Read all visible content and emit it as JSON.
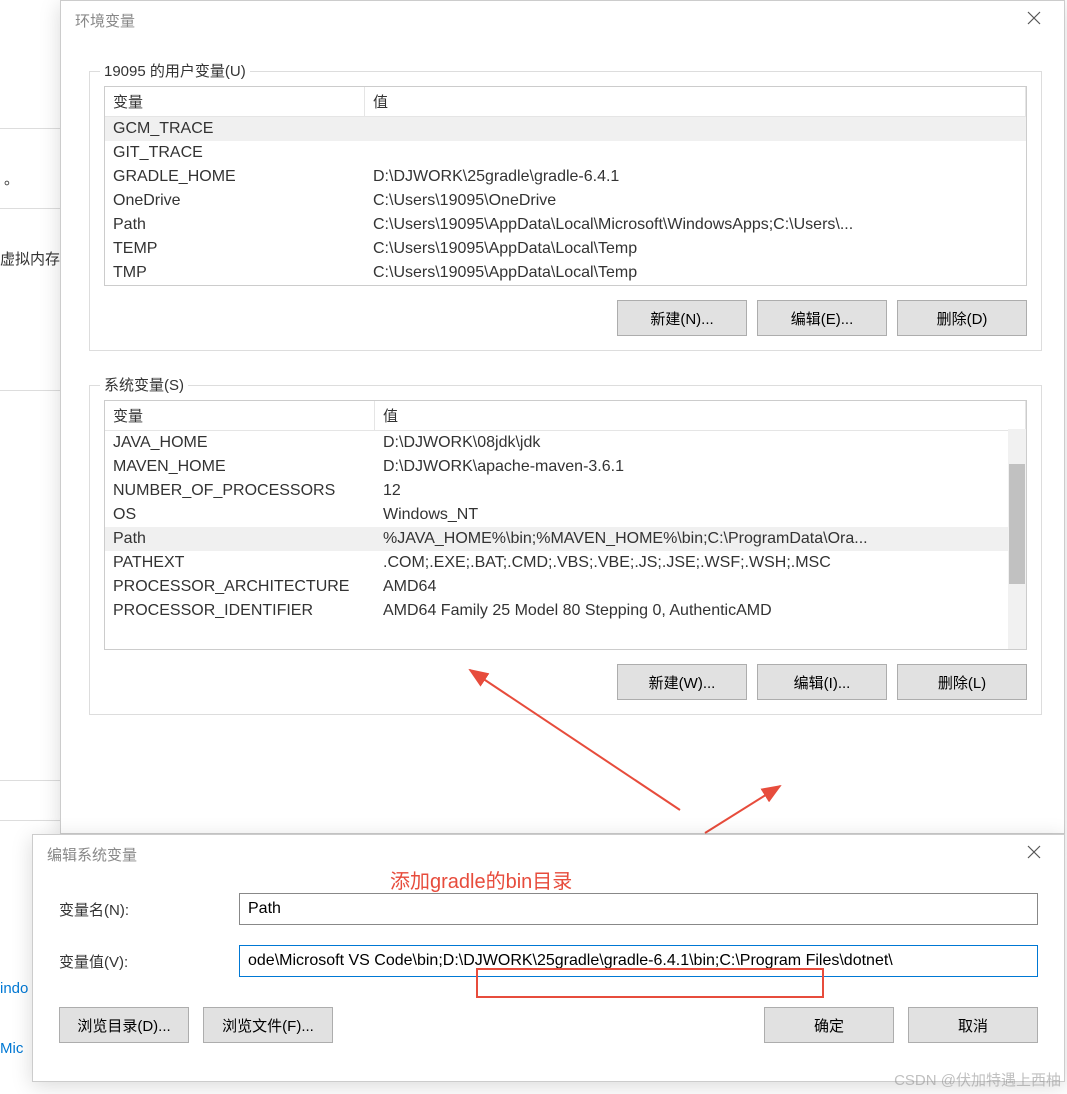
{
  "bg": {
    "dot": "。",
    "virtual": "虚拟内存",
    "windo": "indo",
    "mic": "Mic"
  },
  "dialog_env": {
    "title": "环境变量",
    "user_group_label": "19095 的用户变量(U)",
    "sys_group_label": "系统变量(S)",
    "col_name": "变量",
    "col_value": "值",
    "user_vars": [
      {
        "name": "GCM_TRACE",
        "value": ""
      },
      {
        "name": "GIT_TRACE",
        "value": ""
      },
      {
        "name": "GRADLE_HOME",
        "value": "D:\\DJWORK\\25gradle\\gradle-6.4.1"
      },
      {
        "name": "OneDrive",
        "value": "C:\\Users\\19095\\OneDrive"
      },
      {
        "name": "Path",
        "value": "C:\\Users\\19095\\AppData\\Local\\Microsoft\\WindowsApps;C:\\Users\\..."
      },
      {
        "name": "TEMP",
        "value": "C:\\Users\\19095\\AppData\\Local\\Temp"
      },
      {
        "name": "TMP",
        "value": "C:\\Users\\19095\\AppData\\Local\\Temp"
      }
    ],
    "sys_vars": [
      {
        "name": "JAVA_HOME",
        "value": "D:\\DJWORK\\08jdk\\jdk"
      },
      {
        "name": "MAVEN_HOME",
        "value": "D:\\DJWORK\\apache-maven-3.6.1"
      },
      {
        "name": "NUMBER_OF_PROCESSORS",
        "value": "12"
      },
      {
        "name": "OS",
        "value": "Windows_NT"
      },
      {
        "name": "Path",
        "value": "%JAVA_HOME%\\bin;%MAVEN_HOME%\\bin;C:\\ProgramData\\Ora..."
      },
      {
        "name": "PATHEXT",
        "value": ".COM;.EXE;.BAT;.CMD;.VBS;.VBE;.JS;.JSE;.WSF;.WSH;.MSC"
      },
      {
        "name": "PROCESSOR_ARCHITECTURE",
        "value": "AMD64"
      },
      {
        "name": "PROCESSOR_IDENTIFIER",
        "value": "AMD64 Family 25 Model 80 Stepping 0, AuthenticAMD"
      }
    ],
    "buttons": {
      "new_user": "新建(N)...",
      "edit_user": "编辑(E)...",
      "delete_user": "删除(D)",
      "new_sys": "新建(W)...",
      "edit_sys": "编辑(I)...",
      "delete_sys": "删除(L)"
    }
  },
  "dialog_edit": {
    "title": "编辑系统变量",
    "name_label": "变量名(N):",
    "value_label": "变量值(V):",
    "name_value": "Path",
    "value_value": "ode\\Microsoft VS Code\\bin;D:\\DJWORK\\25gradle\\gradle-6.4.1\\bin;C:\\Program Files\\dotnet\\",
    "buttons": {
      "browse_dir": "浏览目录(D)...",
      "browse_file": "浏览文件(F)...",
      "ok": "确定",
      "cancel": "取消"
    }
  },
  "annotation_text": "添加gradle的bin目录",
  "watermark": "CSDN @伏加特遇上西柚"
}
